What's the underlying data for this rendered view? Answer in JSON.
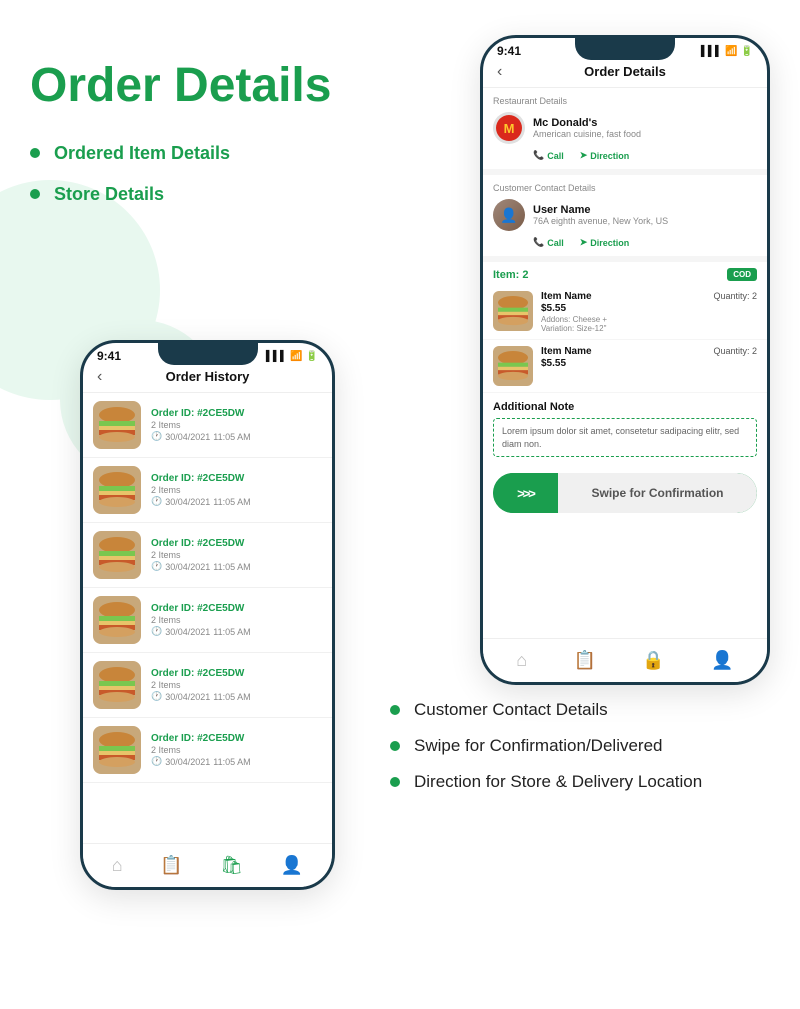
{
  "page": {
    "title": "Order Details",
    "bullets": [
      "Ordered Item Details",
      "Store Details"
    ],
    "bottom_bullets": [
      "Customer Contact Details",
      "Swipe for Confirmation/Delivered",
      "Direction for Store & Delivery Location"
    ]
  },
  "phone_left": {
    "status_time": "9:41",
    "header": "Order History",
    "orders": [
      {
        "id": "#2CE5DW",
        "items": "2 Items",
        "date": "30/04/2021",
        "time": "11:05 AM"
      },
      {
        "id": "#2CE5DW",
        "items": "2 Items",
        "date": "30/04/2021",
        "time": "11:05 AM"
      },
      {
        "id": "#2CE5DW",
        "items": "2 Items",
        "date": "30/04/2021",
        "time": "11:05 AM"
      },
      {
        "id": "#2CE5DW",
        "items": "2 Items",
        "date": "30/04/2021",
        "time": "11:05 AM"
      },
      {
        "id": "#2CE5DW",
        "items": "2 Items",
        "date": "30/04/2021",
        "time": "11:05 AM"
      },
      {
        "id": "#2CE5DW",
        "items": "2 Items",
        "date": "30/04/2021",
        "time": "11:05 AM"
      }
    ],
    "order_label": "Order ID: "
  },
  "phone_right": {
    "status_time": "9:41",
    "header": "Order Details",
    "restaurant_section_label": "Restaurant Details",
    "restaurant": {
      "name": "Mc Donald's",
      "cuisine": "American cuisine, fast food"
    },
    "call_label": "Call",
    "direction_label": "Direction",
    "customer_section_label": "Customer Contact Details",
    "customer": {
      "name": "User Name",
      "address": "76A eighth avenue, New York, US"
    },
    "item_count_label": "Item: ",
    "item_count": "2",
    "cod_label": "COD",
    "items": [
      {
        "name": "Item Name",
        "price": "$5.55",
        "addons": "Cheese +",
        "variation": "Size-12\"",
        "quantity": "2"
      },
      {
        "name": "Item Name",
        "price": "$5.55",
        "addons": "",
        "variation": "",
        "quantity": "2"
      }
    ],
    "additional_note_title": "Additional Note",
    "additional_note_text": "Lorem ipsum dolor sit amet, consetetur sadipacing elitr, sed diam non.",
    "swipe_arrows": ">>>",
    "swipe_label": "Swipe for Confirmation"
  },
  "colors": {
    "green": "#1a9e4e",
    "dark": "#1a3a4a",
    "gray": "#888888"
  }
}
